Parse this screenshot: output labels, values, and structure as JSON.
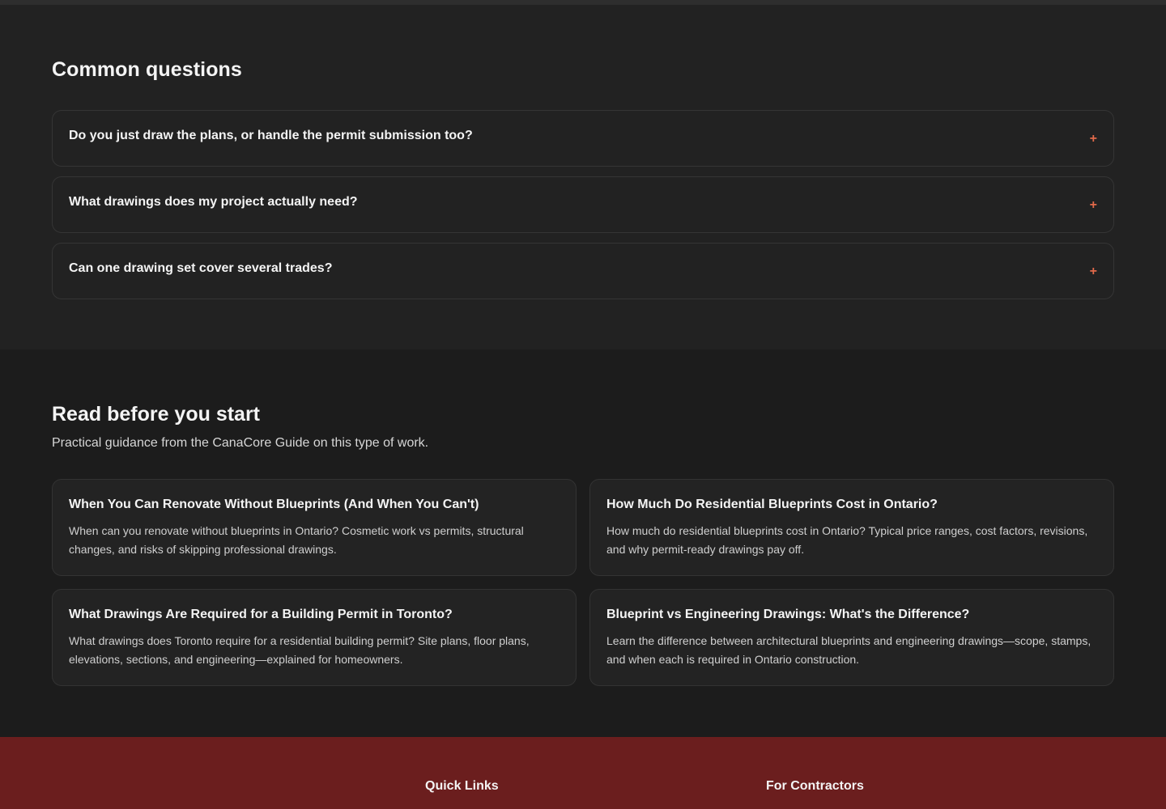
{
  "faq": {
    "title": "Common questions",
    "items": [
      {
        "question": "Do you just draw the plans, or handle the permit submission too?",
        "toggle": "+"
      },
      {
        "question": "What drawings does my project actually need?",
        "toggle": "+"
      },
      {
        "question": "Can one drawing set cover several trades?",
        "toggle": "+"
      }
    ]
  },
  "read": {
    "title": "Read before you start",
    "subtitle": "Practical guidance from the CanaCore Guide on this type of work.",
    "cards": [
      {
        "title": "When You Can Renovate Without Blueprints (And When You Can't)",
        "description": "When can you renovate without blueprints in Ontario? Cosmetic work vs permits, structural changes, and risks of skipping professional drawings."
      },
      {
        "title": "How Much Do Residential Blueprints Cost in Ontario?",
        "description": "How much do residential blueprints cost in Ontario? Typical price ranges, cost factors, revisions, and why permit-ready drawings pay off."
      },
      {
        "title": "What Drawings Are Required for a Building Permit in Toronto?",
        "description": "What drawings does Toronto require for a residential building permit? Site plans, floor plans, elevations, sections, and engineering—explained for homeowners."
      },
      {
        "title": "Blueprint vs Engineering Drawings: What's the Difference?",
        "description": "Learn the difference between architectural blueprints and engineering drawings—scope, stamps, and when each is required in Ontario construction."
      }
    ]
  },
  "footer": {
    "quick_links": "Quick Links",
    "for_contractors": "For Contractors"
  },
  "colors": {
    "accent": "#e26a4a",
    "footer_bg": "#6b1e1e",
    "faq_bg": "#222222",
    "page_bg": "#1c1c1c"
  }
}
